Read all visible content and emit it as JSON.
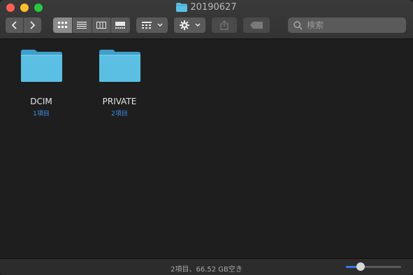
{
  "window": {
    "title": "20190627"
  },
  "toolbar": {
    "back_icon": "chevron-left-icon",
    "forward_icon": "chevron-right-icon",
    "view_modes": [
      "icon-view-icon",
      "list-view-icon",
      "column-view-icon",
      "gallery-view-icon"
    ],
    "active_view": "icon-view-icon",
    "group_icon": "grid-group-icon",
    "action_icon": "gear-icon",
    "share_icon": "share-icon",
    "tag_icon": "tag-icon"
  },
  "search": {
    "placeholder": "検索"
  },
  "items": [
    {
      "name": "DCIM",
      "count": "1項目"
    },
    {
      "name": "PRIVATE",
      "count": "2項目"
    }
  ],
  "status": {
    "info": "2項目、66.52 GB空き",
    "icon_size_fraction": 0.27
  },
  "colors": {
    "accent": "#3d8ee7",
    "folder": "#5bbfe3",
    "background": "#1e1e1f"
  }
}
